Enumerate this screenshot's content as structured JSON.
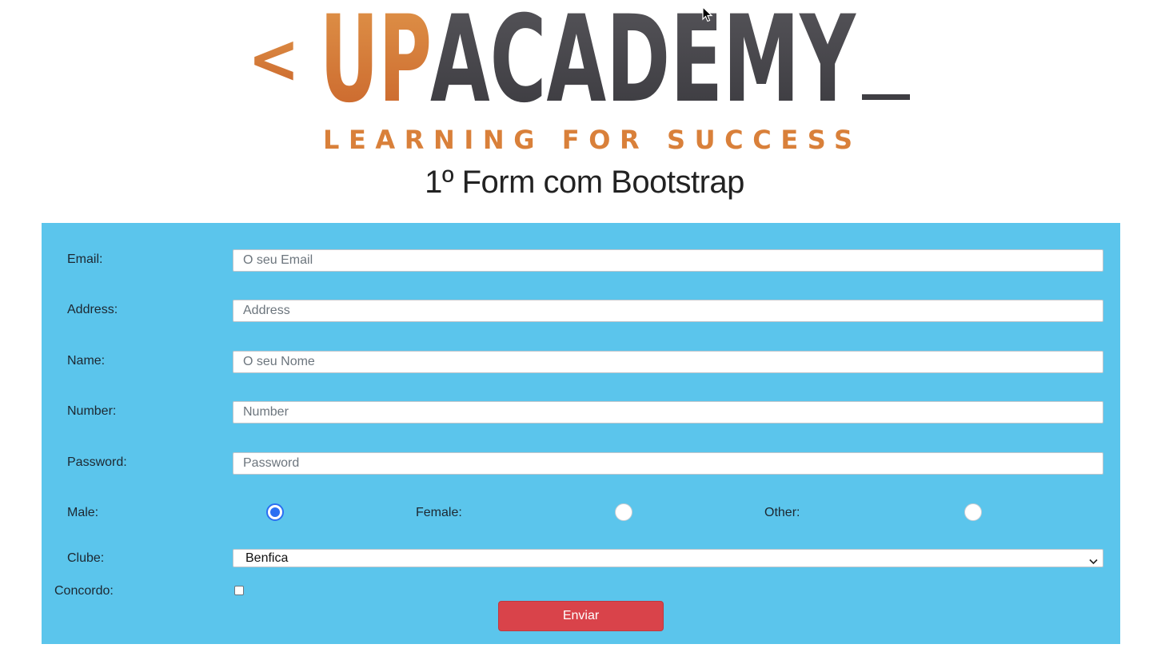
{
  "logo": {
    "bracket": "<",
    "up": "UP",
    "academy": "ACADEMY",
    "underscore": "_",
    "tagline": "LEARNING FOR SUCCESS",
    "colors": {
      "orange": "#d9803a",
      "dark": "#4b4a4f"
    }
  },
  "page": {
    "title": "1º Form com Bootstrap"
  },
  "form": {
    "background": "#5bc5ec",
    "email": {
      "label": "Email:",
      "placeholder": "O seu Email"
    },
    "address": {
      "label": "Address:",
      "placeholder": "Address"
    },
    "name": {
      "label": "Name:",
      "placeholder": "O seu Nome"
    },
    "number": {
      "label": "Number:",
      "placeholder": "Number"
    },
    "password": {
      "label": "Password:",
      "placeholder": "Password"
    },
    "gender": {
      "male_label": "Male:",
      "female_label": "Female:",
      "other_label": "Other:",
      "selected": "male"
    },
    "club": {
      "label": "Clube:",
      "selected": "Benfica",
      "icon": "chevron-down-icon"
    },
    "agree": {
      "label": "Concordo:",
      "checked": false
    },
    "submit": {
      "label": "Enviar",
      "color": "#d9434a"
    }
  }
}
